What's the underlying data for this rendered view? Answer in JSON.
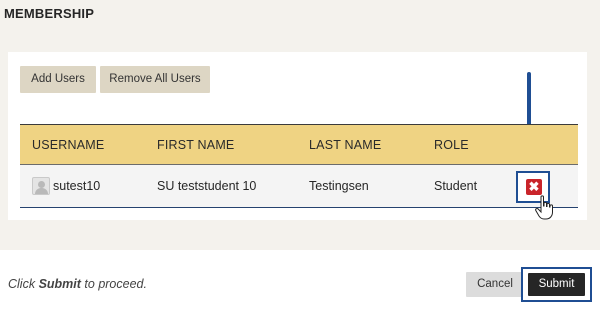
{
  "section": {
    "title": "MEMBERSHIP"
  },
  "toolbar": {
    "add_users_label": "Add Users",
    "remove_all_label": "Remove All Users"
  },
  "table": {
    "columns": [
      "USERNAME",
      "FIRST NAME",
      "LAST NAME",
      "ROLE"
    ],
    "rows": [
      {
        "username": "sutest10",
        "first_name": "SU teststudent 10",
        "last_name": "Testingsen",
        "role": "Student"
      }
    ]
  },
  "icons": {
    "avatar": "user-avatar-icon",
    "delete": "delete-x-icon",
    "cursor": "hand-pointer-icon",
    "arrow": "down-arrow-icon"
  },
  "colors": {
    "header_bg": "#efd383",
    "accent_blue": "#1f4e93",
    "delete_red": "#c9242a",
    "submit_bg": "#262626",
    "tan_button": "#ddd6c4",
    "panel_bg": "#f4f2ed"
  },
  "footer": {
    "instruction_prefix": "Click",
    "instruction_action": "Submit",
    "instruction_suffix": "to proceed.",
    "cancel_label": "Cancel",
    "submit_label": "Submit"
  }
}
